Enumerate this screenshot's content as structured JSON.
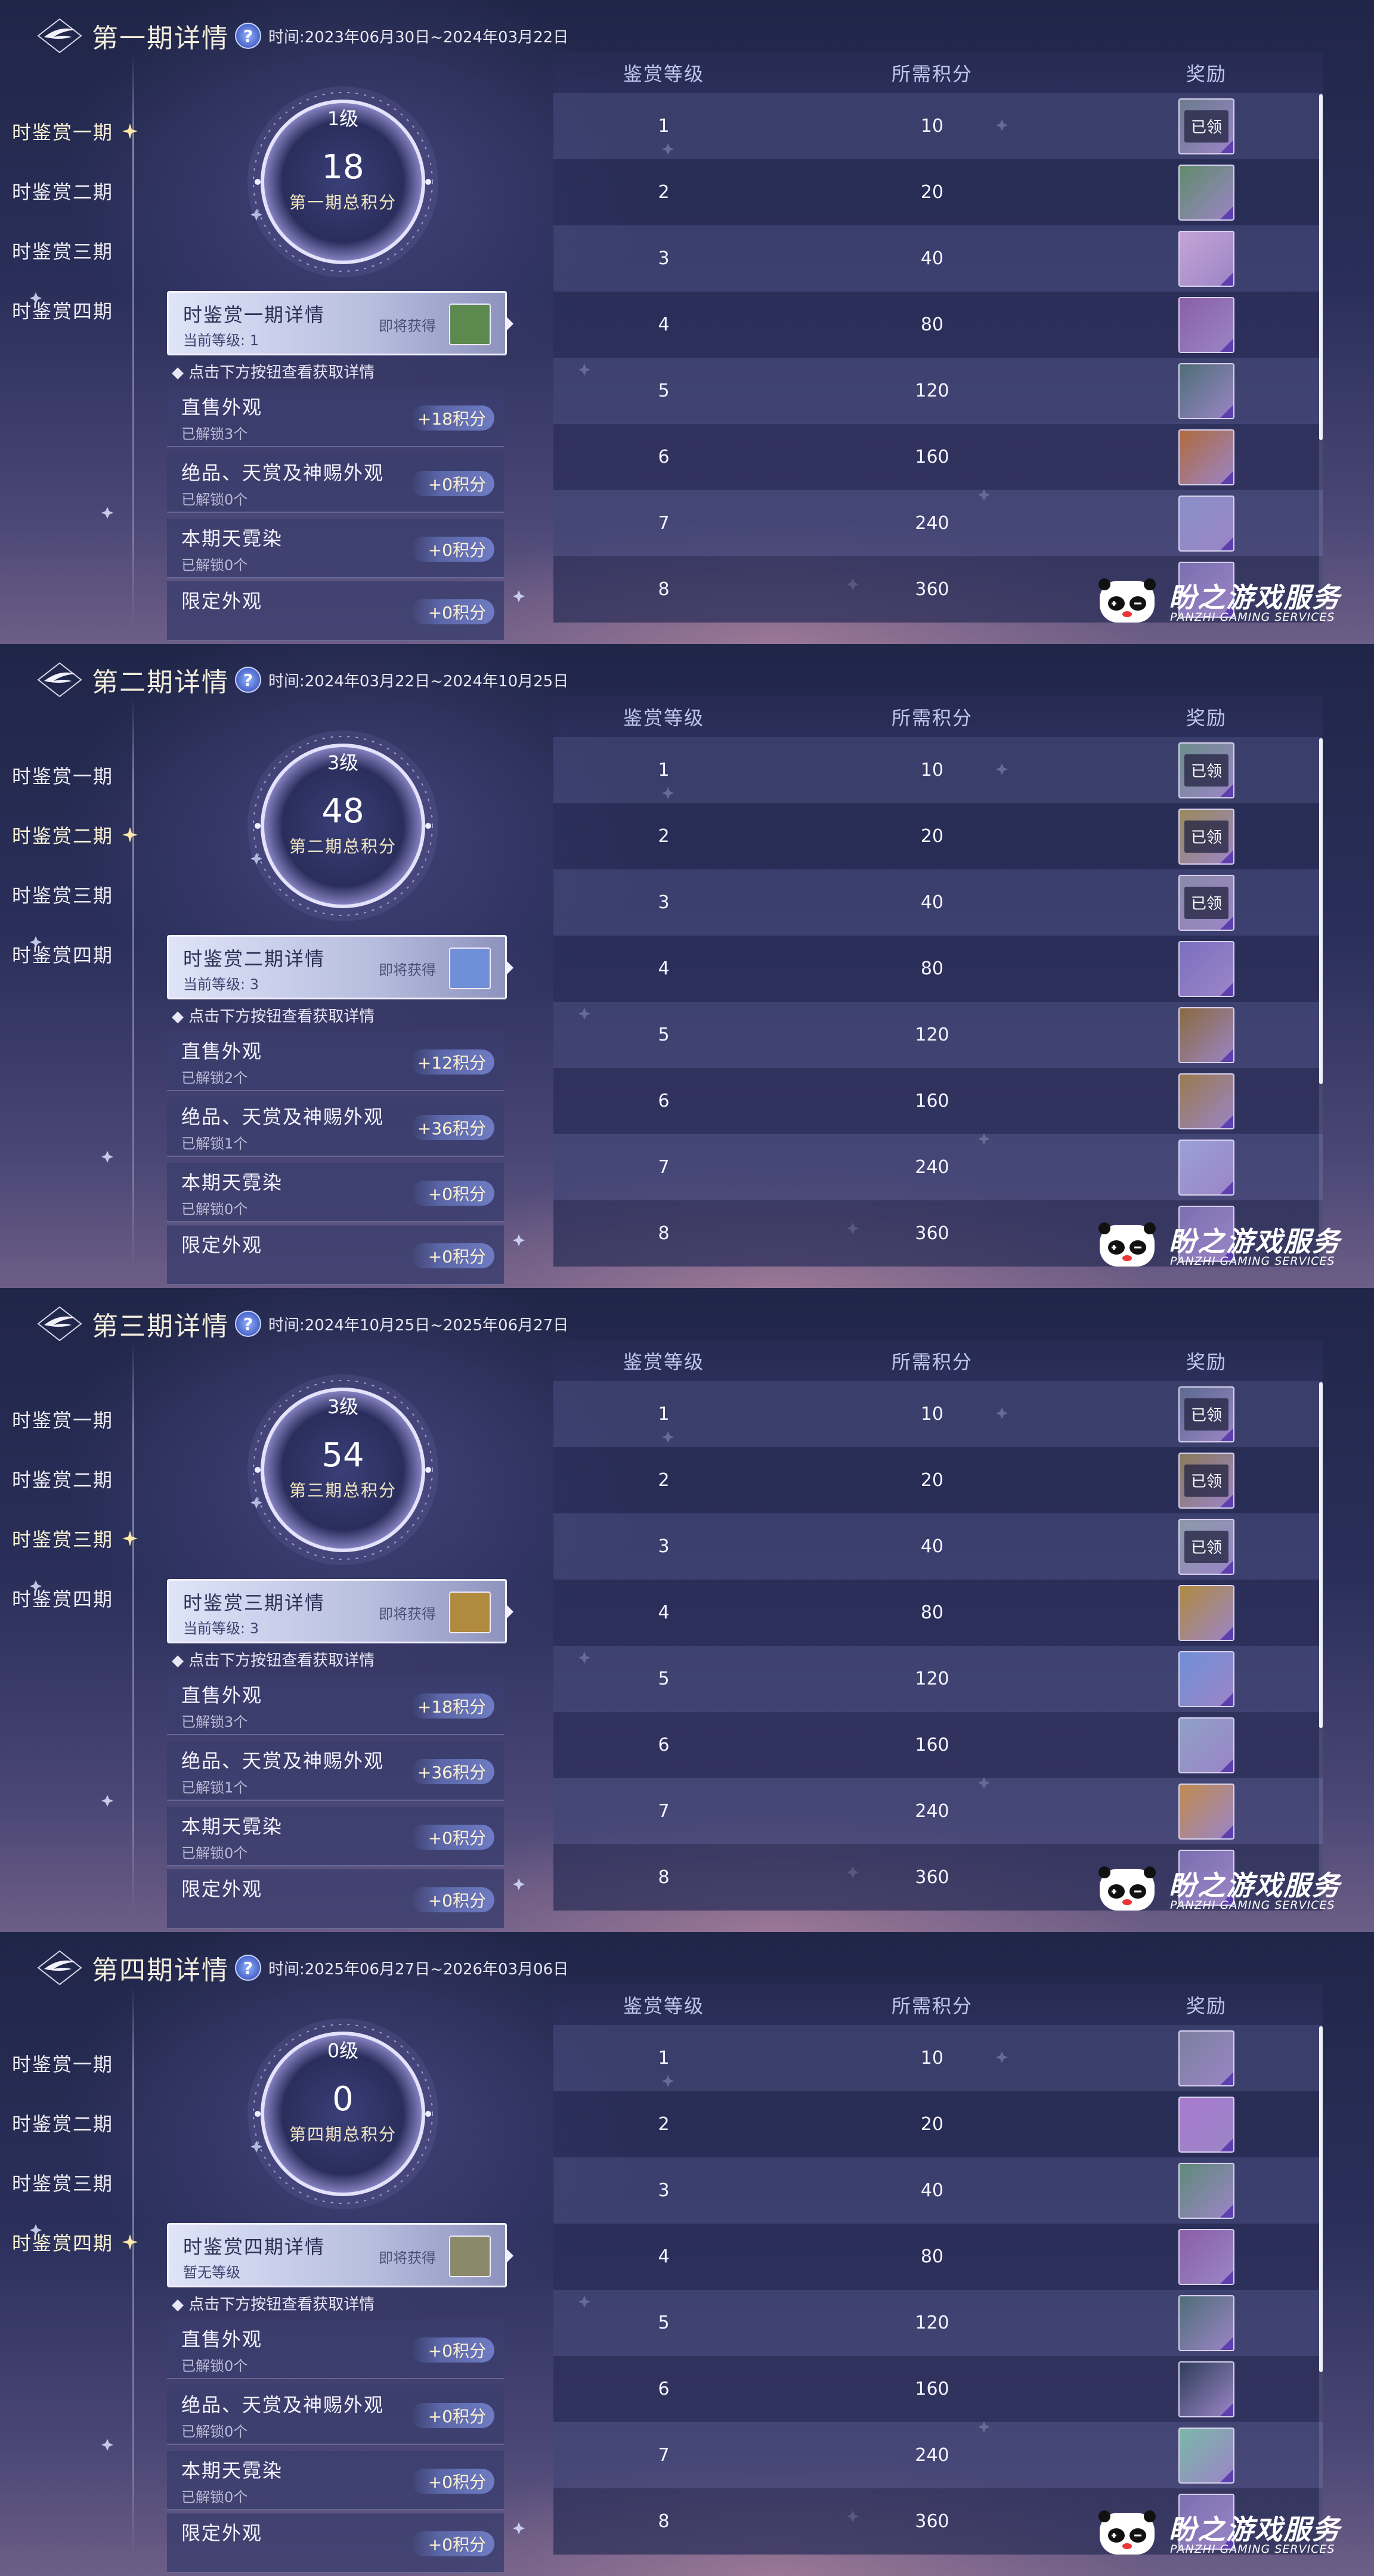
{
  "time_label": "时间: ",
  "hint": "◆ 点击下方按钮查看获取详情",
  "soon_label": "即将获得",
  "nav": [
    "时鉴赏一期",
    "时鉴赏二期",
    "时鉴赏三期",
    "时鉴赏四期"
  ],
  "table_headers": [
    "鉴赏等级",
    "所需积分",
    "奖励"
  ],
  "watermark": {
    "main": "盼之游戏服务",
    "sub": "PANZHI GAMING SERVICES"
  },
  "panels": [
    {
      "title": "第一期详情",
      "time": "2023年06月30日~2024年03月22日",
      "active_nav": 0,
      "ring": {
        "level": "1级",
        "score": "18",
        "caption": "第一期总积分"
      },
      "detail": {
        "title": "时鉴赏一期详情",
        "sub": "当前等级: 1",
        "thumb_color": "#5c8a4e"
      },
      "cats": [
        {
          "title": "直售外观",
          "sub": "已解锁3个",
          "points": "+18积分"
        },
        {
          "title": "绝品、天赏及神赐外观",
          "sub": "已解锁0个",
          "points": "+0积分"
        },
        {
          "title": "本期天霓染",
          "sub": "已解锁0个",
          "points": "+0积分"
        },
        {
          "title": "限定外观",
          "sub": "",
          "points": "+0积分"
        }
      ],
      "rows": [
        {
          "level": "1",
          "points": "10",
          "claimed": "已领",
          "color": "#6b7b8e"
        },
        {
          "level": "2",
          "points": "20",
          "claimed": "",
          "color": "#5f8c6a"
        },
        {
          "level": "3",
          "points": "40",
          "claimed": "",
          "color": "#c6a4d6"
        },
        {
          "level": "4",
          "points": "80",
          "claimed": "",
          "color": "#8a5fa8"
        },
        {
          "level": "5",
          "points": "120",
          "claimed": "",
          "color": "#4e6e78"
        },
        {
          "level": "6",
          "points": "160",
          "claimed": "",
          "color": "#b06a3e"
        },
        {
          "level": "7",
          "points": "240",
          "claimed": "",
          "color": "#8890c8"
        },
        {
          "level": "8",
          "points": "360",
          "claimed": "",
          "color": "#7a6fb0"
        }
      ]
    },
    {
      "title": "第二期详情",
      "time": "2024年03月22日~2024年10月25日",
      "active_nav": 1,
      "ring": {
        "level": "3级",
        "score": "48",
        "caption": "第二期总积分"
      },
      "detail": {
        "title": "时鉴赏二期详情",
        "sub": "当前等级: 3",
        "thumb_color": "#6f8fd8"
      },
      "cats": [
        {
          "title": "直售外观",
          "sub": "已解锁2个",
          "points": "+12积分"
        },
        {
          "title": "绝品、天赏及神赐外观",
          "sub": "已解锁1个",
          "points": "+36积分"
        },
        {
          "title": "本期天霓染",
          "sub": "已解锁0个",
          "points": "+0积分"
        },
        {
          "title": "限定外观",
          "sub": "",
          "points": "+0积分"
        }
      ],
      "rows": [
        {
          "level": "1",
          "points": "10",
          "claimed": "已领",
          "color": "#6b8e8a"
        },
        {
          "level": "2",
          "points": "20",
          "claimed": "已领",
          "color": "#9a8a5a"
        },
        {
          "level": "3",
          "points": "40",
          "claimed": "已领",
          "color": "#8a8aa8"
        },
        {
          "level": "4",
          "points": "80",
          "claimed": "",
          "color": "#7b6fc0"
        },
        {
          "level": "5",
          "points": "120",
          "claimed": "",
          "color": "#8a6a3e"
        },
        {
          "level": "6",
          "points": "160",
          "claimed": "",
          "color": "#9a7a4e"
        },
        {
          "level": "7",
          "points": "240",
          "claimed": "",
          "color": "#9aa0d8"
        },
        {
          "level": "8",
          "points": "360",
          "claimed": "",
          "color": "#7a6fb0"
        }
      ]
    },
    {
      "title": "第三期详情",
      "time": "2024年10月25日~2025年06月27日",
      "active_nav": 2,
      "ring": {
        "level": "3级",
        "score": "54",
        "caption": "第三期总积分"
      },
      "detail": {
        "title": "时鉴赏三期详情",
        "sub": "当前等级: 3",
        "thumb_color": "#b08a3e"
      },
      "cats": [
        {
          "title": "直售外观",
          "sub": "已解锁3个",
          "points": "+18积分"
        },
        {
          "title": "绝品、天赏及神赐外观",
          "sub": "已解锁1个",
          "points": "+36积分"
        },
        {
          "title": "本期天霓染",
          "sub": "已解锁0个",
          "points": "+0积分"
        },
        {
          "title": "限定外观",
          "sub": "",
          "points": "+0积分"
        }
      ],
      "rows": [
        {
          "level": "1",
          "points": "10",
          "claimed": "已领",
          "color": "#5a6a8e"
        },
        {
          "level": "2",
          "points": "20",
          "claimed": "已领",
          "color": "#8a7a5a"
        },
        {
          "level": "3",
          "points": "40",
          "claimed": "已领",
          "color": "#8a9aa8"
        },
        {
          "level": "4",
          "points": "80",
          "claimed": "",
          "color": "#b08a3e"
        },
        {
          "level": "5",
          "points": "120",
          "claimed": "",
          "color": "#6f8fd8"
        },
        {
          "level": "6",
          "points": "160",
          "claimed": "",
          "color": "#8ea0c8"
        },
        {
          "level": "7",
          "points": "240",
          "claimed": "",
          "color": "#c08a4e"
        },
        {
          "level": "8",
          "points": "360",
          "claimed": "",
          "color": "#7a6fb0"
        }
      ]
    },
    {
      "title": "第四期详情",
      "time": "2025年06月27日~2026年03月06日",
      "active_nav": 3,
      "ring": {
        "level": "0级",
        "score": "0",
        "caption": "第四期总积分"
      },
      "detail": {
        "title": "时鉴赏四期详情",
        "sub": "暂无等级",
        "thumb_color": "#8a8a6a"
      },
      "cats": [
        {
          "title": "直售外观",
          "sub": "已解锁0个",
          "points": "+0积分"
        },
        {
          "title": "绝品、天赏及神赐外观",
          "sub": "已解锁0个",
          "points": "+0积分"
        },
        {
          "title": "本期天霓染",
          "sub": "已解锁0个",
          "points": "+0积分"
        },
        {
          "title": "限定外观",
          "sub": "",
          "points": "+0积分"
        }
      ],
      "rows": [
        {
          "level": "1",
          "points": "10",
          "claimed": "",
          "color": "#7a7f9e"
        },
        {
          "level": "2",
          "points": "20",
          "claimed": "",
          "color": "#a87ad0"
        },
        {
          "level": "3",
          "points": "40",
          "claimed": "",
          "color": "#5f8a7a"
        },
        {
          "level": "4",
          "points": "80",
          "claimed": "",
          "color": "#8a5fa8"
        },
        {
          "level": "5",
          "points": "120",
          "claimed": "",
          "color": "#4e6e78"
        },
        {
          "level": "6",
          "points": "160",
          "claimed": "",
          "color": "#2e3e5a"
        },
        {
          "level": "7",
          "points": "240",
          "claimed": "",
          "color": "#7ab8a8"
        },
        {
          "level": "8",
          "points": "360",
          "claimed": "",
          "color": "#7a6fb0"
        }
      ]
    }
  ]
}
